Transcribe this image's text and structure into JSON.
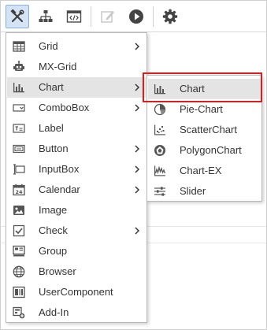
{
  "toolbar": {
    "buttons": [
      {
        "icon": "design-tools-icon",
        "active": true
      },
      {
        "icon": "hierarchy-icon"
      },
      {
        "icon": "code-window-icon"
      },
      {
        "icon": "edit-icon",
        "disabled": true
      },
      {
        "icon": "play-icon"
      },
      {
        "icon": "settings-gear-icon"
      }
    ]
  },
  "menu": {
    "items": [
      {
        "label": "Grid",
        "icon": "grid-icon",
        "has_submenu": true
      },
      {
        "label": "MX-Grid",
        "icon": "robot-icon",
        "has_submenu": false
      },
      {
        "label": "Chart",
        "icon": "bar-chart-icon",
        "has_submenu": true,
        "highlighted": true
      },
      {
        "label": "ComboBox",
        "icon": "combobox-icon",
        "has_submenu": true
      },
      {
        "label": "Label",
        "icon": "label-icon",
        "has_submenu": false
      },
      {
        "label": "Button",
        "icon": "button-icon",
        "has_submenu": true
      },
      {
        "label": "InputBox",
        "icon": "inputbox-icon",
        "has_submenu": true
      },
      {
        "label": "Calendar",
        "icon": "calendar-icon",
        "has_submenu": true
      },
      {
        "label": "Image",
        "icon": "image-icon",
        "has_submenu": false
      },
      {
        "label": "Check",
        "icon": "checkbox-icon",
        "has_submenu": true
      },
      {
        "label": "Group",
        "icon": "group-icon",
        "has_submenu": false
      },
      {
        "label": "Browser",
        "icon": "globe-icon",
        "has_submenu": false
      },
      {
        "label": "UserComponent",
        "icon": "user-component-icon",
        "has_submenu": false
      },
      {
        "label": "Add-In",
        "icon": "add-in-icon",
        "has_submenu": false
      }
    ]
  },
  "submenu": {
    "items": [
      {
        "label": "Chart",
        "icon": "bar-chart-icon",
        "highlighted": true
      },
      {
        "label": "Pie-Chart",
        "icon": "pie-chart-icon"
      },
      {
        "label": "ScatterChart",
        "icon": "scatter-chart-icon"
      },
      {
        "label": "PolygonChart",
        "icon": "polygon-chart-icon"
      },
      {
        "label": "Chart-EX",
        "icon": "chart-ex-icon"
      },
      {
        "label": "Slider",
        "icon": "slider-icon"
      }
    ]
  },
  "colors": {
    "highlight_frame": "#d81e1e",
    "toolbar_active_bg": "#d4e4f6",
    "menu_hover_bg": "#e4e4e4",
    "text": "#333333",
    "icon": "#555555"
  }
}
